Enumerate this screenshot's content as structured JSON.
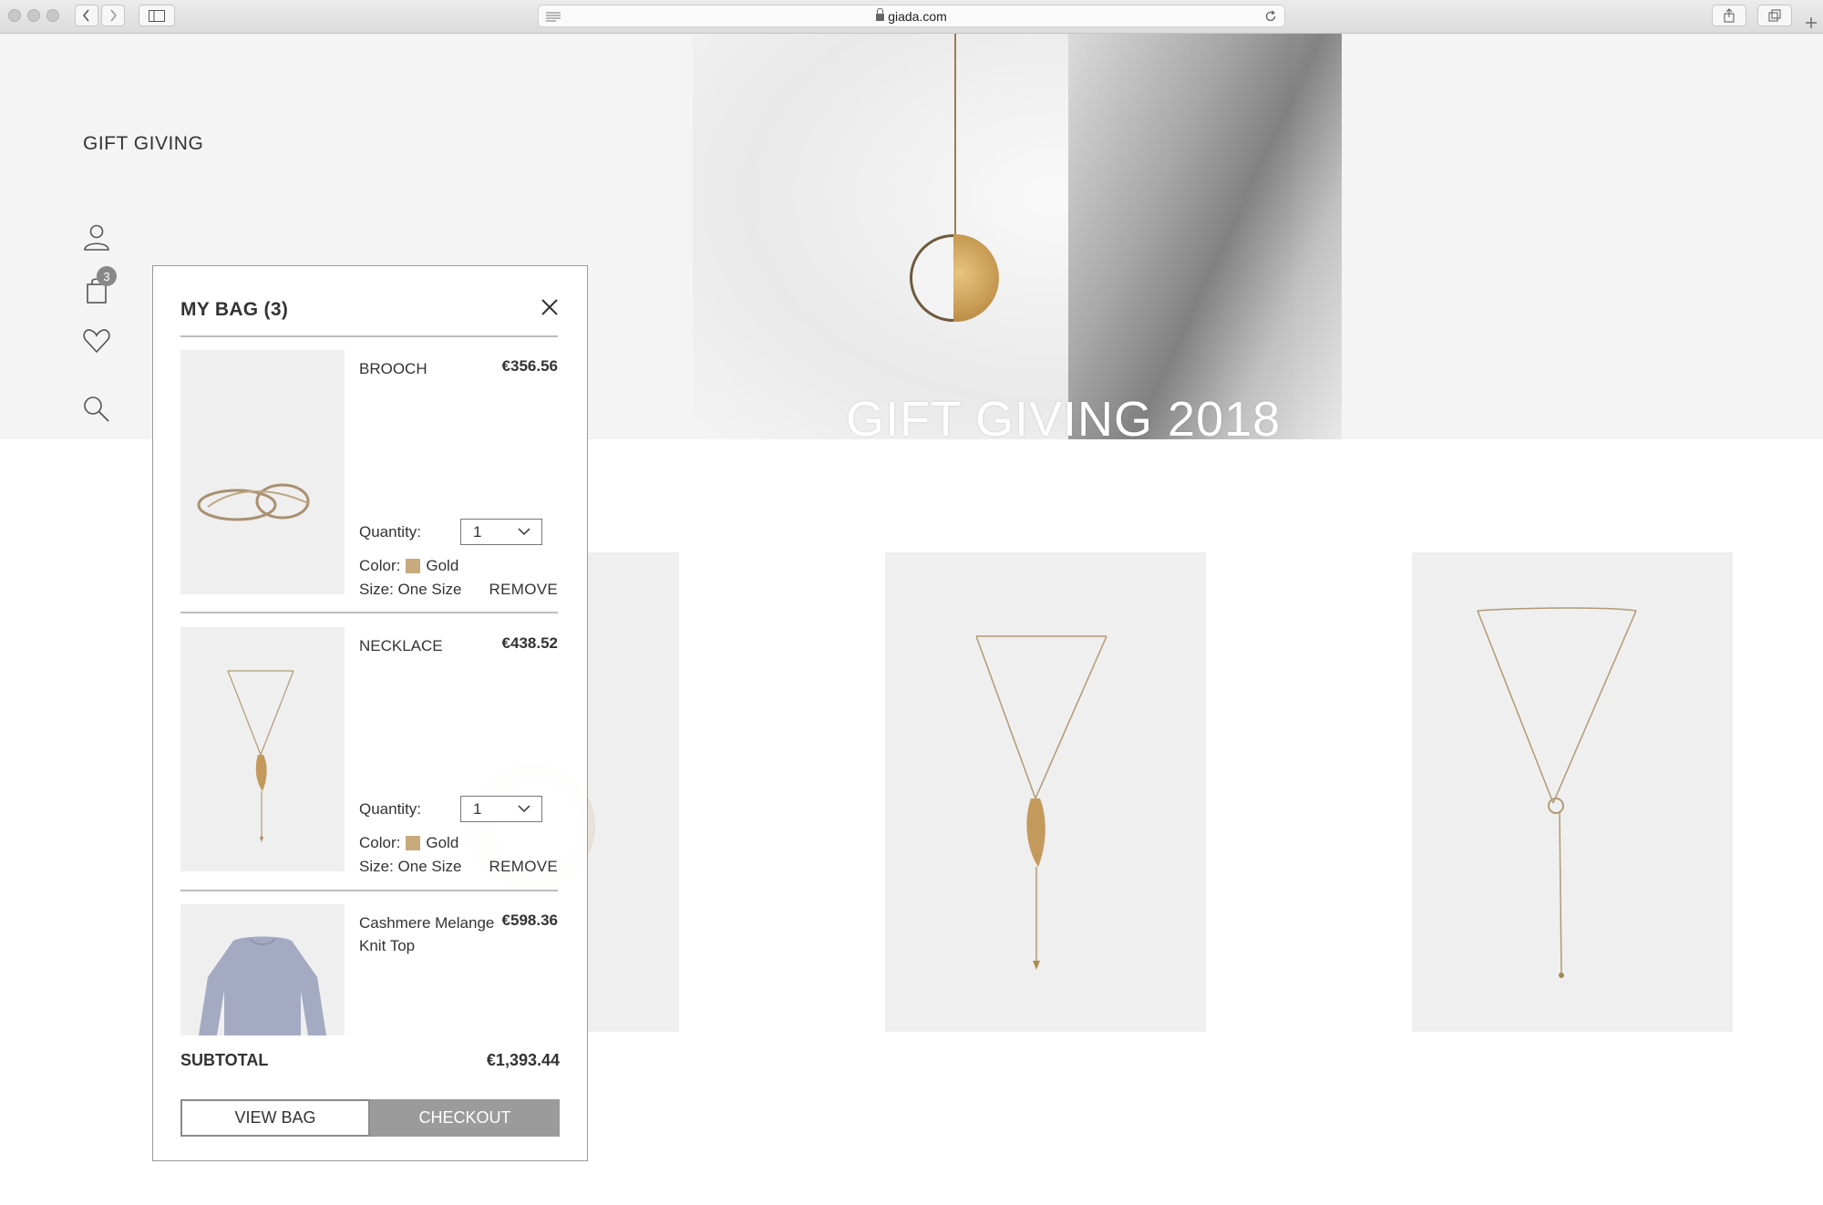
{
  "browser": {
    "url": "giada.com"
  },
  "site": {
    "title": "GIFT GIVING",
    "hero_title": "GIFT GIVING 2018",
    "bag_count": "3"
  },
  "bag": {
    "title": "MY BAG (3)",
    "items": [
      {
        "name": "BROOCH",
        "price": "€356.56",
        "quantity_label": "Quantity:",
        "quantity": "1",
        "color_label": "Color:",
        "color": "Gold",
        "color_hex": "#c9aa7c",
        "size": "Size: One Size",
        "remove_label": "REMOVE"
      },
      {
        "name": "NECKLACE",
        "price": "€438.52",
        "quantity_label": "Quantity:",
        "quantity": "1",
        "color_label": "Color:",
        "color": "Gold",
        "color_hex": "#c9aa7c",
        "size": "Size: One Size",
        "remove_label": "REMOVE"
      },
      {
        "name": "Cashmere Melange Knit Top",
        "price": "€598.36"
      }
    ],
    "subtotal_label": "SUBTOTAL",
    "subtotal": "€1,393.44",
    "view_bag_label": "VIEW BAG",
    "checkout_label": "CHECKOUT"
  }
}
